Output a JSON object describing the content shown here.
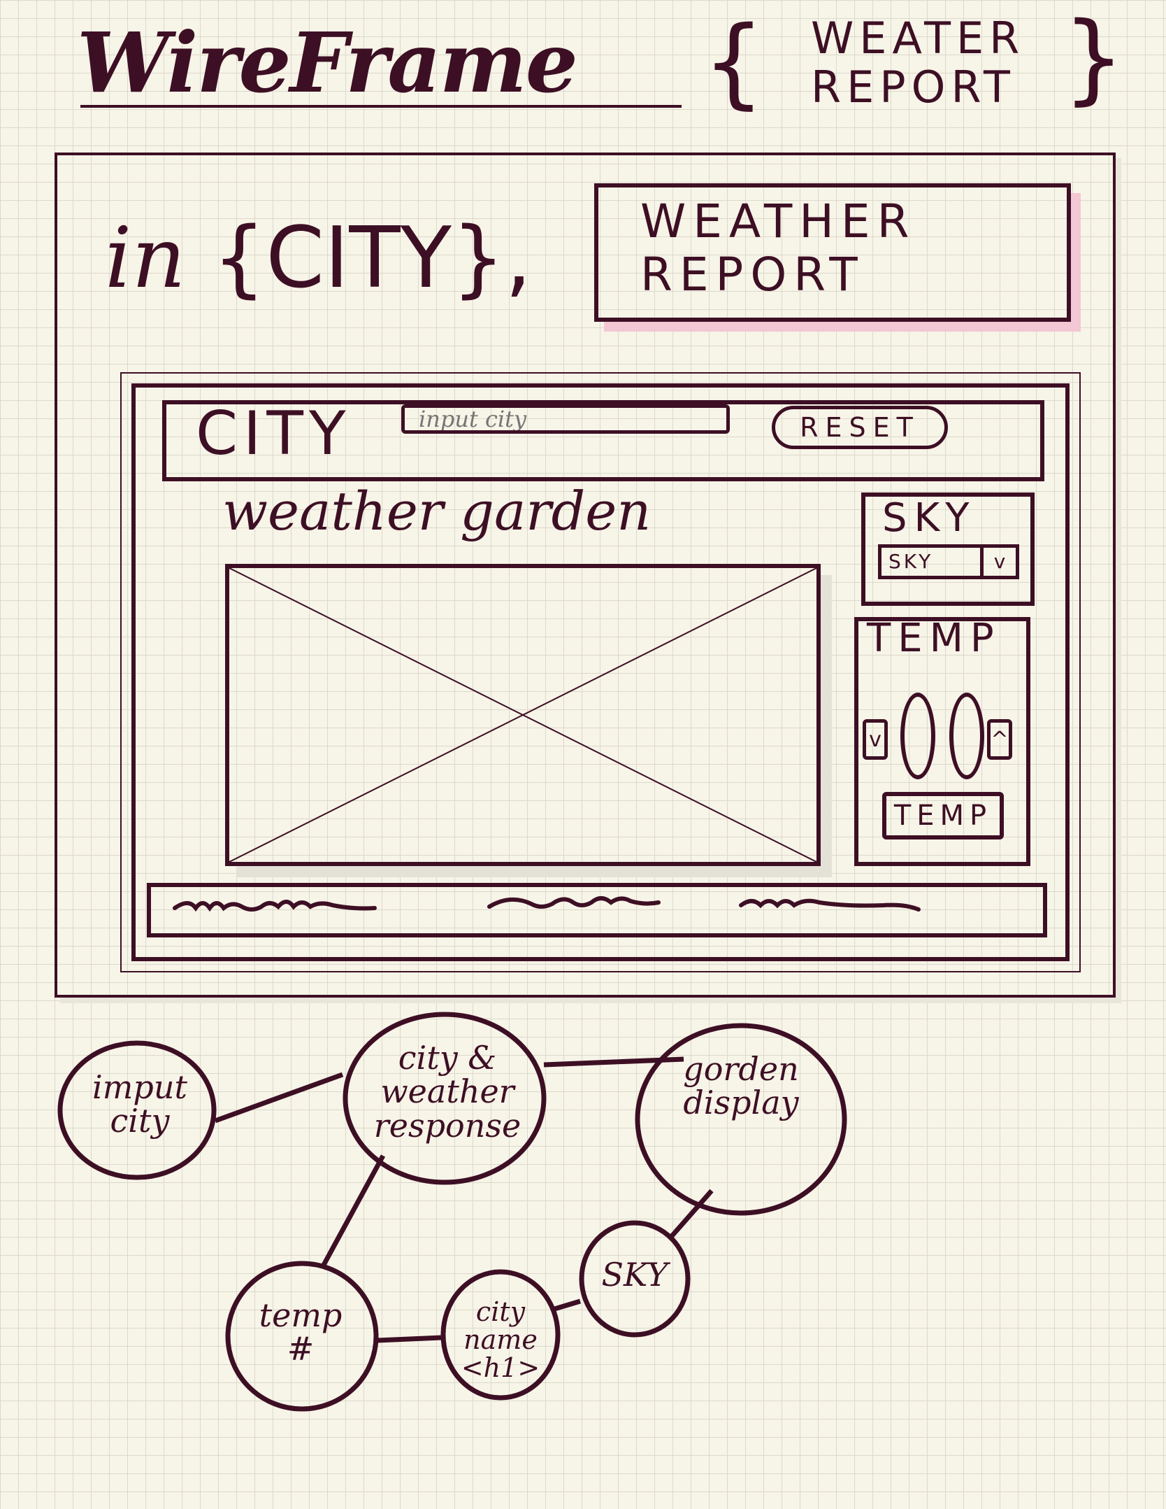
{
  "header": {
    "title": "WireFrame",
    "subtitle_line1": "WEATER",
    "subtitle_line2": "REPORT"
  },
  "page": {
    "intro_text": "in",
    "city_placeholder_text": "CITY",
    "heading_line1": "WEATHER",
    "heading_line2": "REPORT"
  },
  "app": {
    "city_label": "CITY",
    "city_input_placeholder": "input city",
    "reset_label": "RESET",
    "garden_title": "weather garden",
    "sky": {
      "label": "SKY",
      "select_value": "SKY",
      "select_arrow": "v"
    },
    "temp": {
      "label": "TEMP",
      "down_label": "v",
      "up_label": "^",
      "button_label": "TEMP"
    }
  },
  "flow": {
    "nodes": [
      {
        "id": "input-city",
        "label": "imput\ncity"
      },
      {
        "id": "city-weather-response",
        "label": "city &\nweather\nresponse"
      },
      {
        "id": "garden-display",
        "label": "gorden\ndisplay"
      },
      {
        "id": "sky",
        "label": "SKY"
      },
      {
        "id": "city-name",
        "label": "city\nname\n<h1>"
      },
      {
        "id": "temp",
        "label": "temp\n#"
      }
    ]
  }
}
